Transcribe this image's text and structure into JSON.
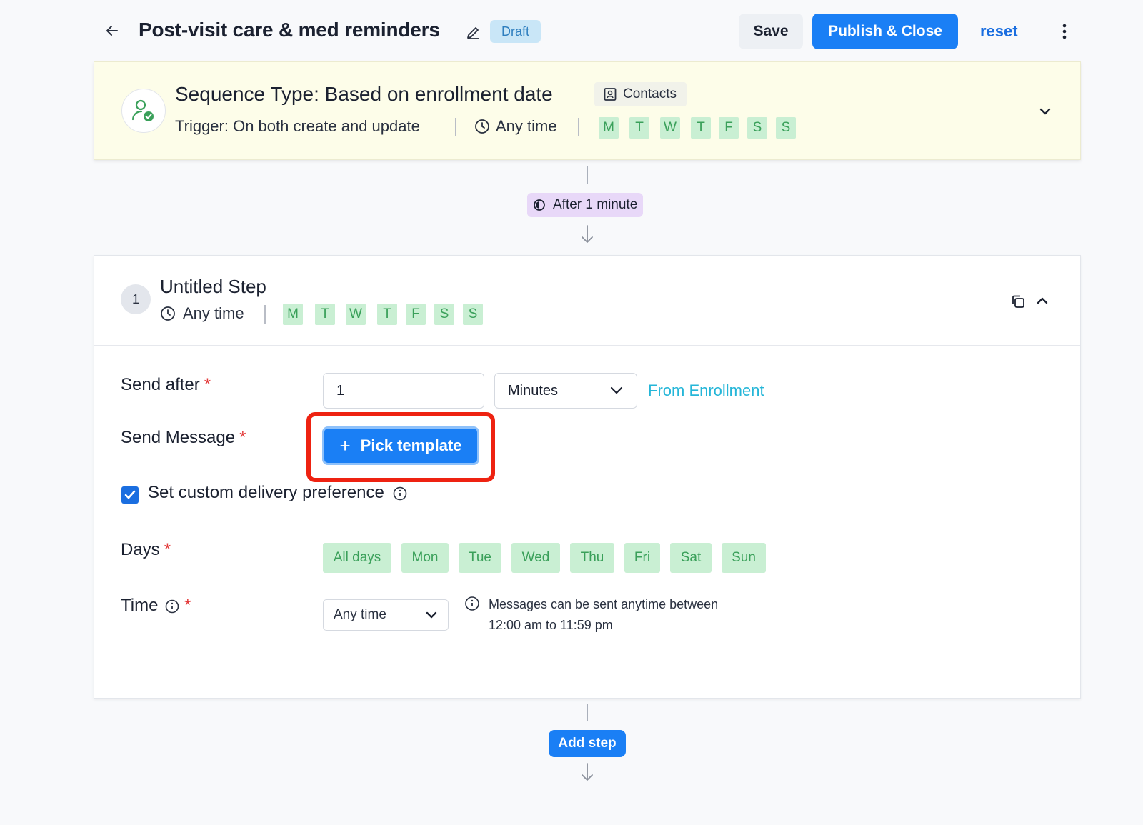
{
  "header": {
    "title": "Post-visit care & med reminders",
    "status_badge": "Draft",
    "save_label": "Save",
    "publish_label": "Publish & Close",
    "reset_label": "reset"
  },
  "sequence": {
    "title": "Sequence Type: Based on enrollment date",
    "contacts_label": "Contacts",
    "trigger": "Trigger: On both create and update",
    "time": "Any time",
    "days": [
      "M",
      "T",
      "W",
      "T",
      "F",
      "S",
      "S"
    ]
  },
  "delay": {
    "label": "After 1 minute"
  },
  "step": {
    "number": "1",
    "title": "Untitled Step",
    "time": "Any time",
    "days": [
      "M",
      "T",
      "W",
      "T",
      "F",
      "S",
      "S"
    ],
    "send_after_label": "Send after",
    "send_after_value": "1",
    "unit_value": "Minutes",
    "from_label": "From Enrollment",
    "send_message_label": "Send Message",
    "pick_template_label": "Pick template",
    "custom_delivery_label": "Set custom delivery preference",
    "custom_delivery_checked": true,
    "days_label": "Days",
    "day_options": [
      "All days",
      "Mon",
      "Tue",
      "Wed",
      "Thu",
      "Fri",
      "Sat",
      "Sun"
    ],
    "time_label": "Time",
    "time_value": "Any time",
    "time_info_line1": "Messages can be sent anytime between",
    "time_info_line2": "12:00 am to 11:59 pm"
  },
  "add_step_label": "Add step",
  "colors": {
    "primary": "#1a7ff5",
    "day_pill_bg": "#c9efd3",
    "day_pill_text": "#3aa05a",
    "sequence_bg": "#fdfde9",
    "highlight": "#ee2211",
    "link": "#25b6d8"
  }
}
